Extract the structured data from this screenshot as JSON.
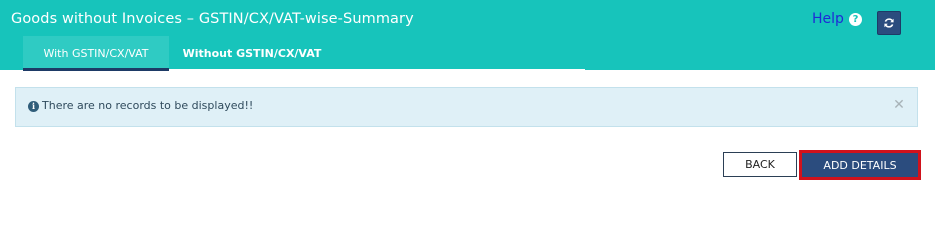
{
  "header": {
    "title": "Goods without Invoices – GSTIN/CX/VAT-wise-Summary",
    "help_label": "Help",
    "help_icon": "question-circle-icon",
    "refresh_icon": "refresh-icon",
    "background_color": "#17c4bb"
  },
  "tabs": [
    {
      "label": "With GSTIN/CX/VAT",
      "active": true
    },
    {
      "label": "Without GSTIN/CX/VAT",
      "active": false
    }
  ],
  "alert": {
    "icon": "info-circle-icon",
    "message": "There are no records to be displayed!!",
    "close_icon": "close-icon"
  },
  "actions": {
    "back_label": "BACK",
    "add_details_label": "ADD DETAILS",
    "primary_color": "#2b4c7e",
    "highlight_color": "#d0121c"
  }
}
